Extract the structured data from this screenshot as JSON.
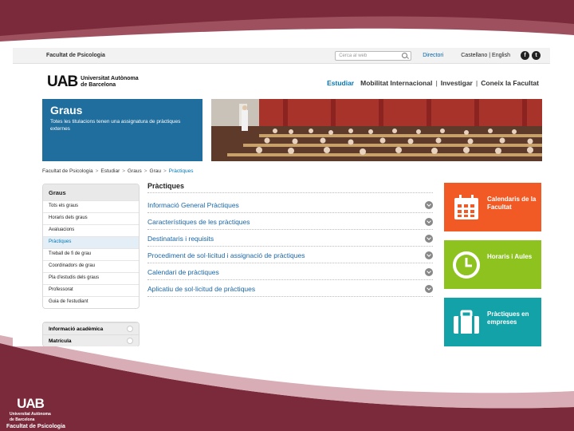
{
  "slide": {
    "logo_mark": "UAB",
    "logo_line1": "Universitat Autònoma",
    "logo_line2": "de Barcelona",
    "logo_faculty": "Facultat de Psicologia"
  },
  "topbar": {
    "faculty": "Facultat de Psicologia",
    "search_placeholder": "Cerca al web",
    "directory": "Directori",
    "language": "Castellano | English",
    "social": [
      "f",
      "t"
    ]
  },
  "header": {
    "logo_mark": "UAB",
    "logo_line1": "Universitat Autònoma",
    "logo_line2": "de Barcelona",
    "nav": [
      "Estudiar",
      "Mobilitat Internacional",
      "Investigar",
      "Coneix la Facultat"
    ]
  },
  "hero": {
    "title": "Graus",
    "subtitle": "Totes les titulacions tenen una assignatura de pràctiques externes"
  },
  "breadcrumb": [
    "Facultat de Psicologia",
    "Estudiar",
    "Graus",
    "Grau",
    "Pràctiques"
  ],
  "sidebar": {
    "head": "Graus",
    "items": [
      "Tots els graus",
      "Horaris dels graus",
      "Avaluacions",
      "Pràctiques",
      "Treball de fi de grau",
      "Coordinadors de grau",
      "Pla d'estudis dels graus",
      "Professorat",
      "Guia de l'estudiant"
    ],
    "active_index": 3,
    "accordions": [
      "Informació acadèmica",
      "Matrícula"
    ]
  },
  "content": {
    "title": "Pràctiques",
    "rows": [
      "Informació General Pràctiques",
      "Característiques de les pràctiques",
      "Destinataris i requisits",
      "Procediment de sol·licitud i assignació de pràctiques",
      "Calendari de pràctiques",
      "Aplicatiu de sol·licitud de pràctiques"
    ]
  },
  "tiles": [
    {
      "label": "Calendaris de la Facultat",
      "color": "#f15a24",
      "icon": "calendar-icon"
    },
    {
      "label": "Horaris i Aules",
      "color": "#8dc21f",
      "icon": "clock-icon"
    },
    {
      "label": "Pràctiques en empreses",
      "color": "#12a2a8",
      "icon": "briefcase-icon"
    }
  ]
}
